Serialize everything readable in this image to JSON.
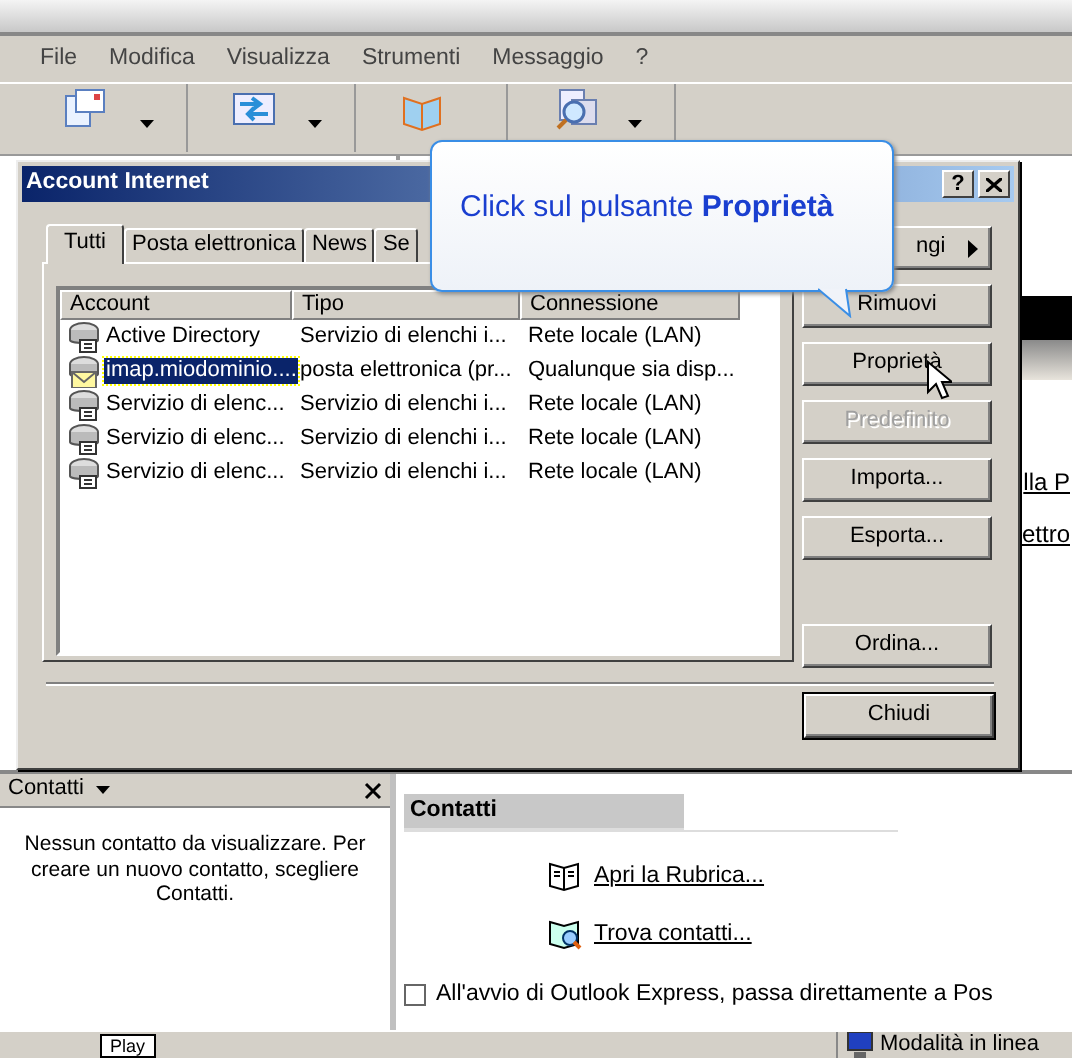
{
  "menu": [
    "File",
    "Modifica",
    "Visualizza",
    "Strumenti",
    "Messaggio",
    "?"
  ],
  "toolbar": [
    {
      "dropdown": true
    },
    {
      "dropdown": true
    },
    {
      "dropdown": false
    },
    {
      "dropdown": true
    }
  ],
  "content_fragments": [
    "lla P",
    "ettro"
  ],
  "dialog": {
    "title": "Account Internet",
    "help_button": "?",
    "tabs": [
      {
        "label": "Tutti",
        "selected": true
      },
      {
        "label": "Posta elettronica",
        "selected": false
      },
      {
        "label": "News",
        "selected": false
      },
      {
        "label": "Se",
        "selected": false
      }
    ],
    "columns": [
      "Account",
      "Tipo",
      "Connessione"
    ],
    "rows": [
      {
        "kind": "directory",
        "account": "Active Directory",
        "type": "Servizio di elenchi i...",
        "connection": "Rete locale (LAN)",
        "selected": false
      },
      {
        "kind": "mail",
        "account": "imap.miodominio....",
        "type": "posta elettronica (pr...",
        "connection": "Qualunque sia disp...",
        "selected": true
      },
      {
        "kind": "directory",
        "account": "Servizio di elenc...",
        "type": "Servizio di elenchi i...",
        "connection": "Rete locale (LAN)",
        "selected": false
      },
      {
        "kind": "directory",
        "account": "Servizio di elenc...",
        "type": "Servizio di elenchi i...",
        "connection": "Rete locale (LAN)",
        "selected": false
      },
      {
        "kind": "directory",
        "account": "Servizio di elenc...",
        "type": "Servizio di elenchi i...",
        "connection": "Rete locale (LAN)",
        "selected": false
      }
    ],
    "buttons": [
      {
        "label": "ngi",
        "disabled": false,
        "submenu": true
      },
      {
        "label": "Rimuovi",
        "disabled": false,
        "submenu": false
      },
      {
        "label": "Proprietà",
        "disabled": false,
        "submenu": false
      },
      {
        "label": "Predefinito",
        "disabled": true,
        "submenu": false
      },
      {
        "label": "Importa...",
        "disabled": false,
        "submenu": false
      },
      {
        "label": "Esporta...",
        "disabled": false,
        "submenu": false
      },
      {
        "label": "Ordina...",
        "disabled": false,
        "submenu": false
      }
    ],
    "close_button": "Chiudi"
  },
  "callout": {
    "text": "Click sul pulsante **Proprietà**"
  },
  "contacts_pane": {
    "title": "Contatti",
    "message": "Nessun contatto da visualizzare. Per creare un nuovo contatto, scegliere Contatti."
  },
  "contacts_page": {
    "heading": "Contatti",
    "links": [
      {
        "kind": "book",
        "label": "Apri la Rubrica..."
      },
      {
        "kind": "find",
        "label": "Trova contatti..."
      }
    ],
    "startup_option": {
      "label": "All'avvio di Outlook Express, passa direttamente a Pos",
      "checked": false
    }
  },
  "status_bar": {
    "button": "Play",
    "status": "Modalità in linea"
  }
}
